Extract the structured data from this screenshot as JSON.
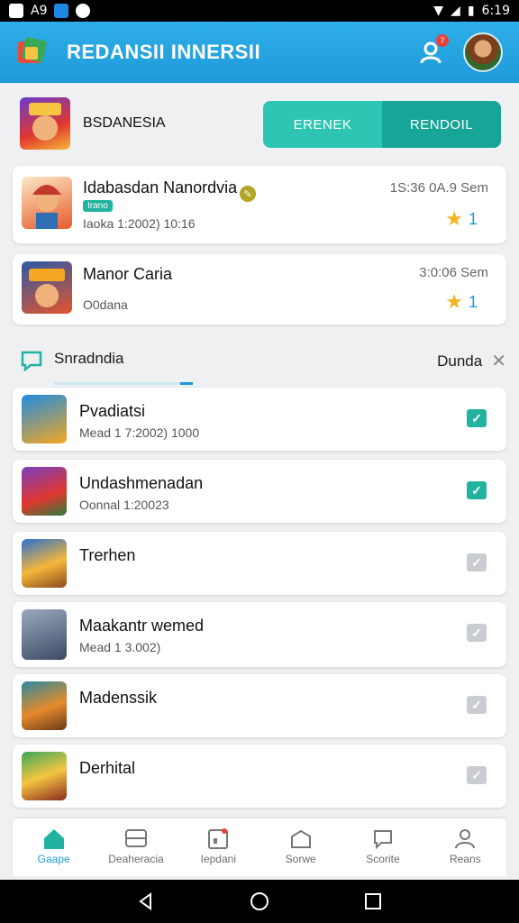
{
  "status_bar": {
    "left_text": "A9",
    "time": "6:19"
  },
  "app_bar": {
    "title": "REDANSII INNERSII",
    "notification_count": "7"
  },
  "top": {
    "label": "BSDANESIA",
    "button_primary": "ERENEK",
    "button_secondary": "RENDOIL"
  },
  "featured": [
    {
      "name": "Idabasdan Nanordvia",
      "tag": "Irano",
      "sub": "Iaoka 1:2002) 10:16",
      "time": "1S:36 0A.9  Sem",
      "rating": "1"
    },
    {
      "name": "Manor Caria",
      "sub": "O0dana",
      "time": "3:0:06  Sem",
      "rating": "1"
    }
  ],
  "section": {
    "title": "Snradndia",
    "action": "Dunda"
  },
  "list": [
    {
      "name": "Pvadiatsi",
      "sub": "Mead 1 7:2002) 1000",
      "checked": true
    },
    {
      "name": "Undashmenadan",
      "sub": "Oonnal 1:20023",
      "checked": true
    },
    {
      "name": "Trerhen",
      "sub": "",
      "checked": false
    },
    {
      "name": "Maakantr  wemed",
      "sub": "Mead 1 3.002)",
      "checked": false
    },
    {
      "name": "Madenssik",
      "sub": "",
      "checked": false
    },
    {
      "name": "Derhital",
      "sub": "",
      "checked": false
    }
  ],
  "bottom_nav": [
    {
      "label": "Gaape",
      "icon": "home-icon"
    },
    {
      "label": "Deaheracia",
      "icon": "bus-icon"
    },
    {
      "label": "Iepdani",
      "icon": "calendar-icon"
    },
    {
      "label": "Sorwe",
      "icon": "box-icon"
    },
    {
      "label": "Scorite",
      "icon": "chat-icon"
    },
    {
      "label": "Reans",
      "icon": "person-icon"
    }
  ],
  "colors": {
    "primary": "#1e9ad8",
    "teal": "#22b3a0",
    "teal_dark": "#16a597",
    "star": "#f2b51d"
  }
}
